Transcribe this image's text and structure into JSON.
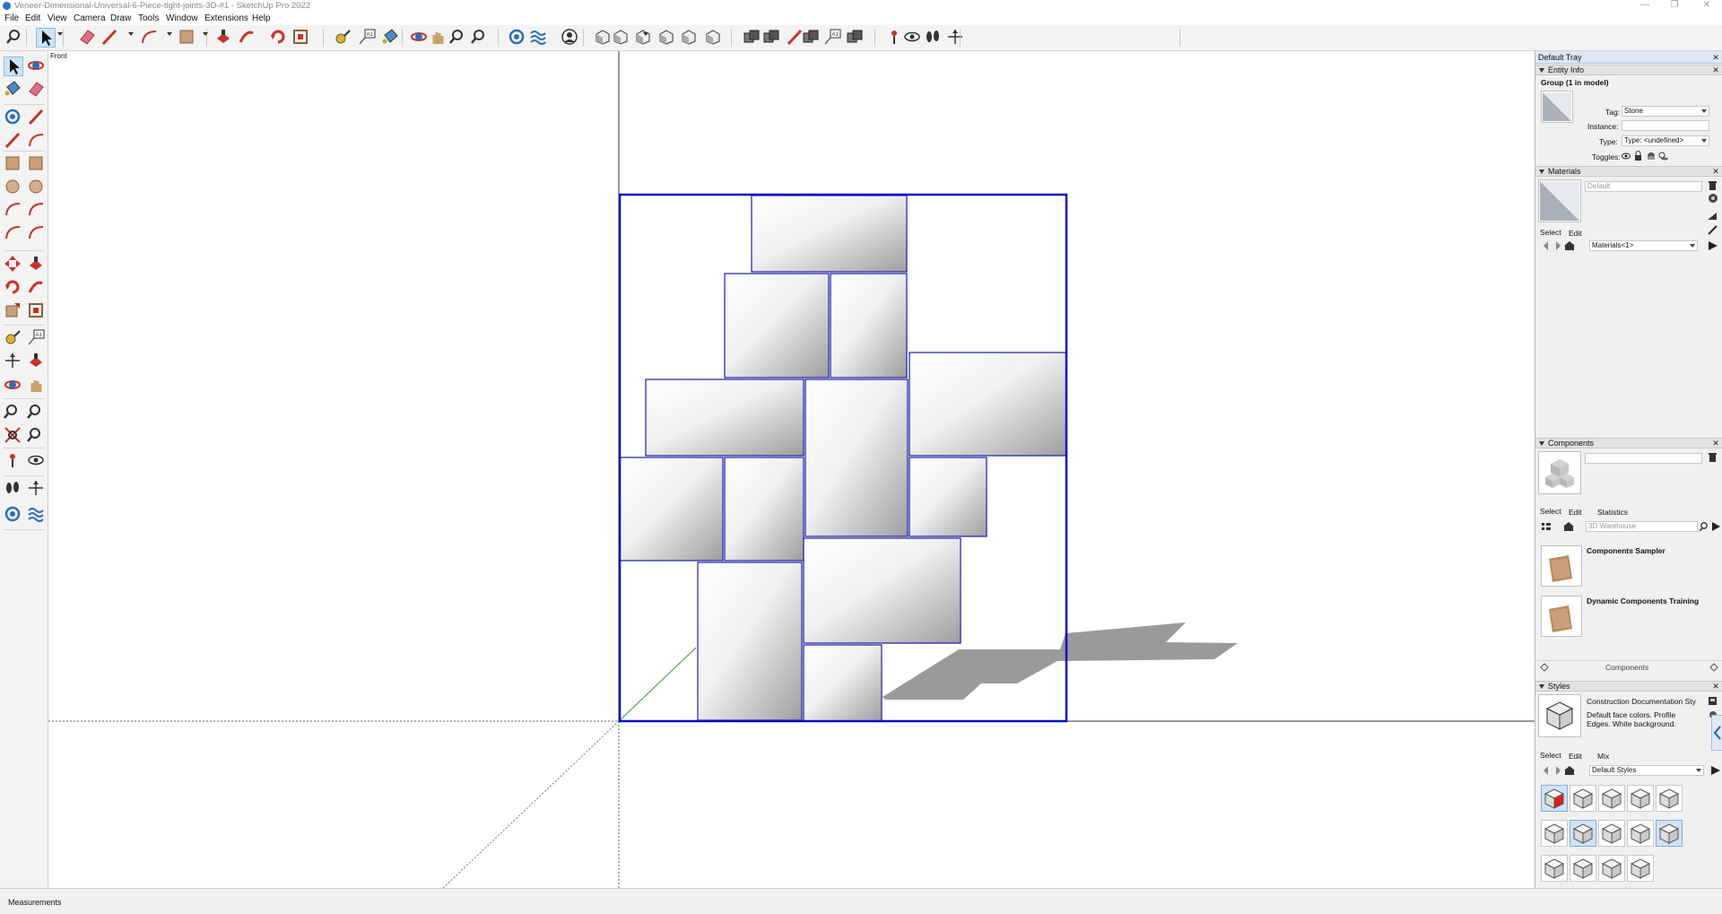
{
  "window": {
    "title": "Veneer-Dimensional-Universal-6-Piece-tight-joints-3D-#1 - SketchUp Pro 2022",
    "controls": [
      "—",
      "❐",
      "✕"
    ]
  },
  "menu": [
    "File",
    "Edit",
    "View",
    "Camera",
    "Draw",
    "Tools",
    "Window",
    "Extensions",
    "Help"
  ],
  "toolbar": {
    "icons": [
      "search-icon",
      "select-icon",
      "eraser-icon",
      "pencil-icon",
      "arc-icon",
      "rectangle-icon",
      "push-pull-icon",
      "follow-me-icon",
      "rotate-icon",
      "offset-icon",
      "tape-measure-icon",
      "text-icon",
      "paint-bucket-icon",
      "orbit-icon",
      "pan-icon",
      "zoom-icon",
      "zoom-extents-icon",
      "section-plane-icon",
      "tag-icon",
      "user-icon",
      "iso-view-icon",
      "top-view-icon",
      "front-view-icon",
      "right-view-icon",
      "back-view-icon",
      "left-view-icon",
      "x-ray-icon",
      "wireframe-icon",
      "hidden-line-icon",
      "shaded-icon",
      "textured-icon",
      "monochrome-icon",
      "position-camera-icon",
      "look-around-icon",
      "walk-icon",
      "axes-icon"
    ]
  },
  "viewport": {
    "scene_label": "Front"
  },
  "status": {
    "measurements_label": "Measurements"
  },
  "tray": {
    "title": "Default Tray",
    "entity_info": {
      "header": "Entity Info",
      "selection": "Group (1 in model)",
      "tag_label": "Tag:",
      "tag_value": "Stone",
      "instance_label": "Instance:",
      "instance_value": "",
      "type_label": "Type:",
      "type_value": "Type: <undefined>",
      "toggles_label": "Toggles:"
    },
    "materials": {
      "header": "Materials",
      "name_value": "Default",
      "tabs": [
        "Select",
        "Edit"
      ],
      "library": "Materials<1>"
    },
    "components": {
      "header": "Components",
      "tabs": [
        "Select",
        "Edit",
        "Statistics"
      ],
      "search_placeholder": "3D Warehouse",
      "items": [
        {
          "name": "Components Sampler"
        },
        {
          "name": "Dynamic Components Training"
        }
      ],
      "footer": "Components"
    },
    "styles": {
      "header": "Styles",
      "style_name": "Construction Documentation Sty",
      "style_description": "Default face colors. Profile Edges. White background.",
      "tabs": [
        "Select",
        "Edit",
        "Mix"
      ],
      "library": "Default Styles"
    }
  }
}
